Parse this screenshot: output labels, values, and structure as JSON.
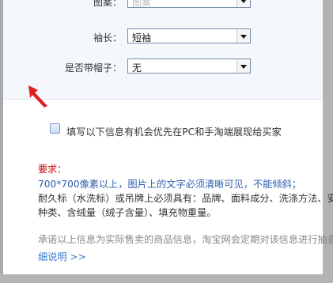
{
  "form": {
    "top_label": "图案：",
    "top_value": "图案",
    "sleeve_label": "袖长：",
    "sleeve_value": "短袖",
    "hood_label": "是否带帽子：",
    "hood_value": "无"
  },
  "checkbox": {
    "label": "填写以下信息有机会优先在PC和手淘端展现给买家"
  },
  "requirements": {
    "title": "要求：",
    "line1": "700*700像素以上，图片上的文字必须清晰可见，不能倾斜；",
    "line2": "耐久标（水洗标）或吊牌上必须具有：品牌、面料成分、洗涤方法、安",
    "line3": "种类、含绒量（绒子含量）、填充物重量。"
  },
  "promise": "承诺以上信息为实际售卖的商品信息，淘宝网会定期对该信息进行抽查",
  "detail_link": "细说明 >>",
  "colors": {
    "required_red": "#cc0000",
    "link_blue": "#3a7ad0",
    "annotation_arrow": "#e02020"
  }
}
